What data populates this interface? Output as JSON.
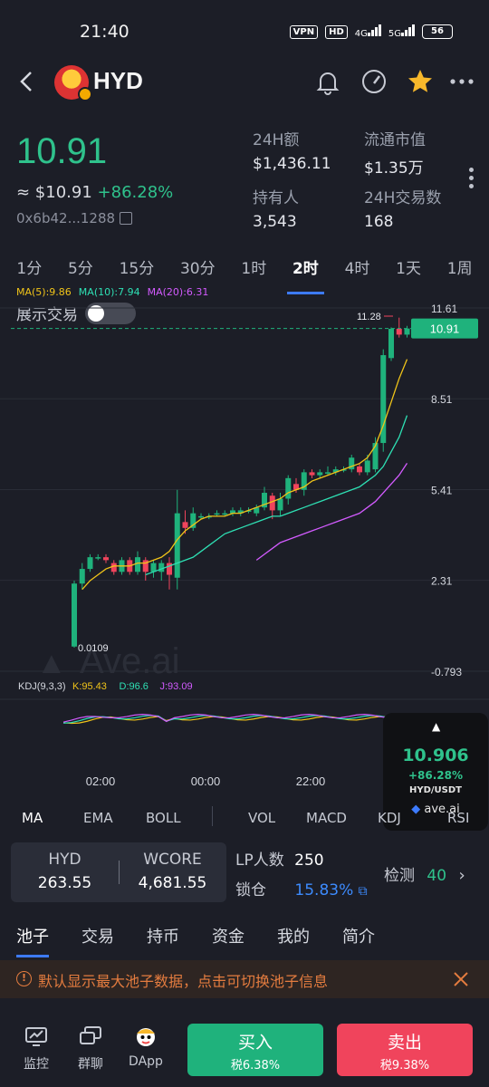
{
  "status_bar": {
    "time": "21:40",
    "vpn": "VPN",
    "hd": "HD",
    "net1": "4G",
    "net2": "5G",
    "battery": "56"
  },
  "header": {
    "title": "HYD"
  },
  "token": {
    "price": "10.91",
    "usd_price": "≈ $10.91",
    "change": "+86.28%",
    "address": "0x6b42...1288"
  },
  "stats": [
    {
      "label": "24H额",
      "value": "$1,436.11"
    },
    {
      "label": "流通市值",
      "value": "$1.35万"
    },
    {
      "label": "持有人",
      "value": "3,543"
    },
    {
      "label": "24H交易数",
      "value": "168"
    }
  ],
  "timeframes": [
    "1分",
    "5分",
    "15分",
    "30分",
    "1时",
    "2时",
    "4时",
    "1天",
    "1周"
  ],
  "active_timeframe": "2时",
  "ma_legend": [
    {
      "text": "MA(5):9.86",
      "color": "#f0c419"
    },
    {
      "text": "MA(10):7.94",
      "color": "#2ee0b4"
    },
    {
      "text": "MA(20):6.31",
      "color": "#d35bff"
    }
  ],
  "show_trades_label": "展示交易",
  "chart_data": {
    "type": "candlestick",
    "ylim": [
      -0.793,
      11.61
    ],
    "y_ticks": [
      "11.61",
      "8.51",
      "5.41",
      "2.31",
      "-0.793"
    ],
    "x_ticks": [
      "02:00",
      "00:00",
      "22:00"
    ],
    "current_price": "10.91",
    "high_label": "11.28",
    "low_label": "0.0109",
    "candles": [
      [
        0.05,
        2.2,
        0.01,
        2.3
      ],
      [
        2.2,
        2.7,
        2.0,
        2.9
      ],
      [
        2.7,
        3.1,
        2.6,
        3.2
      ],
      [
        3.1,
        3.1,
        3.0,
        3.2
      ],
      [
        3.1,
        3.0,
        2.9,
        3.2
      ],
      [
        2.9,
        2.6,
        2.5,
        3.0
      ],
      [
        2.6,
        3.0,
        2.5,
        3.1
      ],
      [
        3.0,
        2.6,
        2.5,
        3.1
      ],
      [
        2.6,
        3.1,
        2.5,
        3.3
      ],
      [
        3.0,
        2.6,
        2.3,
        3.1
      ],
      [
        2.6,
        2.9,
        2.4,
        3.0
      ],
      [
        2.6,
        2.9,
        2.3,
        3.0
      ],
      [
        2.9,
        2.5,
        2.0,
        3.1
      ],
      [
        2.4,
        4.6,
        2.0,
        5.4
      ],
      [
        4.3,
        4.1,
        3.9,
        4.7
      ],
      [
        4.1,
        4.6,
        4.0,
        4.8
      ],
      [
        4.5,
        4.5,
        4.4,
        4.6
      ],
      [
        4.5,
        4.5,
        4.4,
        4.6
      ],
      [
        4.6,
        4.6,
        4.5,
        4.7
      ],
      [
        4.6,
        4.6,
        4.5,
        4.7
      ],
      [
        4.6,
        4.7,
        4.5,
        4.8
      ],
      [
        4.6,
        4.7,
        4.5,
        4.8
      ],
      [
        4.7,
        4.7,
        4.6,
        4.8
      ],
      [
        4.6,
        4.8,
        4.5,
        4.9
      ],
      [
        4.8,
        5.3,
        4.7,
        5.5
      ],
      [
        5.2,
        4.7,
        4.4,
        5.3
      ],
      [
        4.7,
        5.1,
        4.5,
        5.3
      ],
      [
        5.1,
        5.8,
        4.9,
        5.9
      ],
      [
        5.6,
        5.4,
        5.3,
        5.8
      ],
      [
        5.4,
        6.0,
        5.2,
        6.1
      ],
      [
        6.0,
        5.9,
        5.8,
        6.1
      ],
      [
        5.9,
        6.0,
        5.8,
        6.1
      ],
      [
        6.0,
        6.0,
        5.9,
        6.2
      ],
      [
        6.0,
        6.1,
        5.9,
        6.2
      ],
      [
        6.1,
        6.1,
        6.0,
        6.2
      ],
      [
        6.1,
        6.5,
        6.0,
        6.6
      ],
      [
        6.2,
        6.0,
        5.9,
        6.3
      ],
      [
        6.0,
        6.4,
        5.9,
        6.6
      ],
      [
        6.1,
        7.0,
        6.0,
        7.2
      ],
      [
        7.0,
        10.0,
        6.7,
        10.2
      ],
      [
        9.9,
        10.9,
        9.8,
        10.95
      ],
      [
        10.9,
        10.7,
        10.6,
        11.28
      ],
      [
        10.7,
        10.91,
        10.6,
        11.0
      ]
    ],
    "ma5": [
      2.0,
      2.3,
      2.5,
      2.7,
      2.8,
      2.8,
      2.8,
      2.9,
      2.9,
      3.0,
      3.1,
      3.3,
      3.7,
      4.0,
      4.2,
      4.4,
      4.5,
      4.5,
      4.5,
      4.6,
      4.6,
      4.7,
      4.8,
      4.9,
      5.0,
      5.1,
      5.3,
      5.4,
      5.5,
      5.7,
      5.8,
      5.9,
      6.0,
      6.1,
      6.2,
      6.3,
      6.5,
      6.9,
      7.6,
      8.4,
      9.2,
      9.86
    ],
    "ma10": [
      2.5,
      2.6,
      2.7,
      2.8,
      2.9,
      3.0,
      3.1,
      3.3,
      3.5,
      3.7,
      3.9,
      4.0,
      4.1,
      4.2,
      4.3,
      4.4,
      4.5,
      4.5,
      4.6,
      4.7,
      4.8,
      4.9,
      5.0,
      5.1,
      5.2,
      5.3,
      5.4,
      5.5,
      5.7,
      5.9,
      6.2,
      6.7,
      7.2,
      7.94
    ],
    "ma20": [
      3.0,
      3.2,
      3.4,
      3.6,
      3.7,
      3.8,
      3.9,
      4.0,
      4.1,
      4.2,
      4.3,
      4.4,
      4.5,
      4.6,
      4.8,
      5.0,
      5.3,
      5.6,
      5.9,
      6.31
    ],
    "kdj_label": "KDJ(9,3,3)",
    "kdj": [
      {
        "text": "K:95.43",
        "color": "#f0c419"
      },
      {
        "text": "D:96.6",
        "color": "#2ee0b4"
      },
      {
        "text": "J:93.09",
        "color": "#d35bff"
      }
    ]
  },
  "popup": {
    "value": "10.906",
    "change": "+86.28%",
    "pair": "HYD/USDT",
    "brand": "ave.ai"
  },
  "indicator_tabs": [
    "MA",
    "EMA",
    "BOLL",
    "VOL",
    "MACD",
    "KDJ",
    "RSI"
  ],
  "watermark": "Ave.ai",
  "liquidity": {
    "token_a": {
      "name": "HYD",
      "amount": "263.55"
    },
    "token_b": {
      "name": "WCORE",
      "amount": "4,681.55"
    },
    "lp_label": "LP人数",
    "lp_count": "250",
    "lock_label": "锁仓",
    "lock_value": "15.83%",
    "check_label": "检测",
    "check_value": "40"
  },
  "content_tabs": [
    "池子",
    "交易",
    "持币",
    "资金",
    "我的",
    "简介"
  ],
  "notice": "默认显示最大池子数据，点击可切换池子信息",
  "bottom_nav": [
    {
      "label": "监控"
    },
    {
      "label": "群聊"
    },
    {
      "label": "DApp"
    }
  ],
  "buy": {
    "label": "买入",
    "tax": "税6.38%"
  },
  "sell": {
    "label": "卖出",
    "tax": "税9.38%"
  }
}
